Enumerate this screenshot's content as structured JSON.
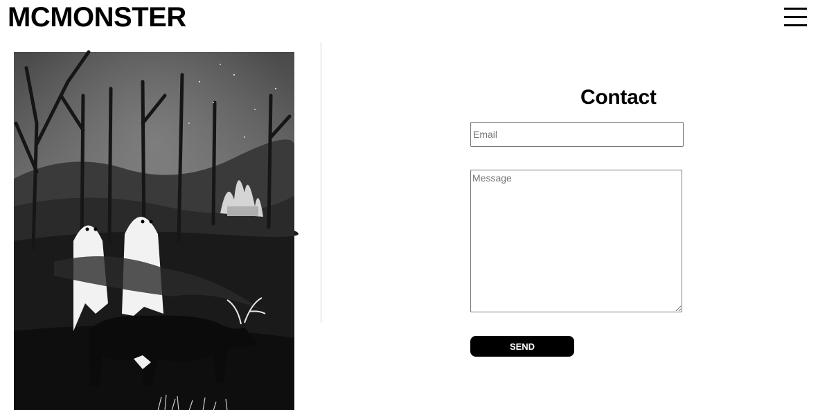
{
  "header": {
    "site_title": "MCMONSTER",
    "menu_icon": "hamburger-menu-icon"
  },
  "artwork": {
    "description_icon": "ink-illustration-ghosts-deer-forest"
  },
  "contact": {
    "title": "Contact",
    "email_placeholder": "Email",
    "message_placeholder": "Message",
    "send_label": "SEND"
  },
  "colors": {
    "background": "#ffffff",
    "text": "#000000",
    "button_bg": "#000000",
    "button_text": "#ffffff",
    "divider": "#d4d4d4"
  }
}
